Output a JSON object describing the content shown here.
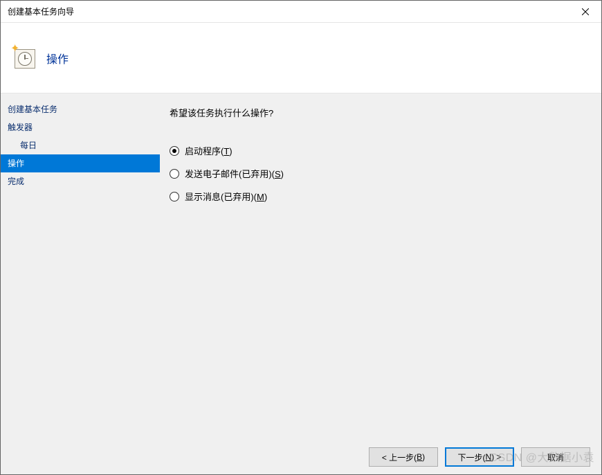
{
  "window": {
    "title": "创建基本任务向导"
  },
  "header": {
    "page_title": "操作"
  },
  "sidebar": {
    "items": [
      {
        "label": "创建基本任务",
        "active": false,
        "indent": false
      },
      {
        "label": "触发器",
        "active": false,
        "indent": false
      },
      {
        "label": "每日",
        "active": false,
        "indent": true
      },
      {
        "label": "操作",
        "active": true,
        "indent": false
      },
      {
        "label": "完成",
        "active": false,
        "indent": false
      }
    ]
  },
  "content": {
    "prompt": "希望该任务执行什么操作?",
    "options": [
      {
        "label_pre": "启动程序(",
        "hotkey": "T",
        "label_post": ")",
        "checked": true
      },
      {
        "label_pre": "发送电子邮件(已弃用)(",
        "hotkey": "S",
        "label_post": ")",
        "checked": false
      },
      {
        "label_pre": "显示消息(已弃用)(",
        "hotkey": "M",
        "label_post": ")",
        "checked": false
      }
    ]
  },
  "footer": {
    "back_pre": "< 上一步(",
    "back_hotkey": "B",
    "back_post": ")",
    "next_pre": "下一步(",
    "next_hotkey": "N",
    "next_post": ") >",
    "cancel": "取消"
  },
  "watermark": "CSDN @大数据小袁"
}
